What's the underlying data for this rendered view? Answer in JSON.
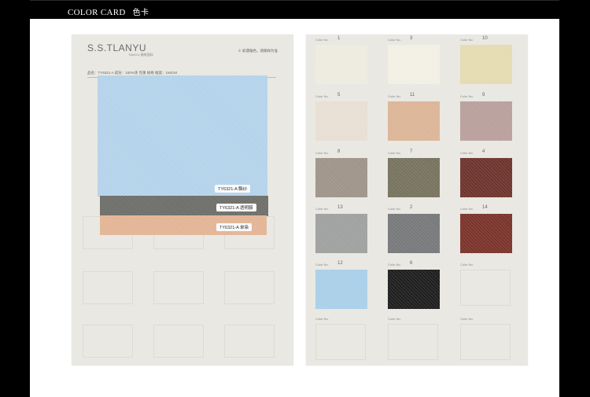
{
  "header": {
    "title": "COLOR CARD",
    "title_cn": "色卡"
  },
  "left_card": {
    "brand": "S.S.TLANYU",
    "brand_sub": "TIANYU 服装面料",
    "note": "※ 如遇偏色，请跟样为准",
    "meta": "品名：TY6321-A 成份：100%涤 克重          规格          幅宽：150CM",
    "labels": [
      "TY6321-A 飘纱",
      "TY6321-A 透明膜",
      "TY6321-A 单染"
    ],
    "colors": {
      "blue": "#b4d3ea",
      "gray": "#6f6f6b",
      "tan": "#e3b494"
    }
  },
  "right_card": {
    "swatches": [
      {
        "num": "1",
        "color": "#eeebe0"
      },
      {
        "num": "3",
        "color": "#f2efe4"
      },
      {
        "num": "10",
        "color": "#e5dbb1"
      },
      {
        "num": "5",
        "color": "#e8dfd4"
      },
      {
        "num": "11",
        "color": "#dcb597"
      },
      {
        "num": "9",
        "color": "#b9a09c"
      },
      {
        "num": "8",
        "color": "#9f948a"
      },
      {
        "num": "7",
        "color": "#77735f"
      },
      {
        "num": "4",
        "color": "#6e352e"
      },
      {
        "num": "13",
        "color": "#9fa1a0"
      },
      {
        "num": "2",
        "color": "#77797b"
      },
      {
        "num": "14",
        "color": "#7a342b"
      },
      {
        "num": "12",
        "color": "#a9cfe9"
      },
      {
        "num": "6",
        "color": "#1f1f1f"
      },
      {
        "num": "",
        "color": ""
      },
      {
        "num": "",
        "color": ""
      },
      {
        "num": "",
        "color": ""
      },
      {
        "num": "",
        "color": ""
      }
    ],
    "color_no_label": "Color No."
  }
}
